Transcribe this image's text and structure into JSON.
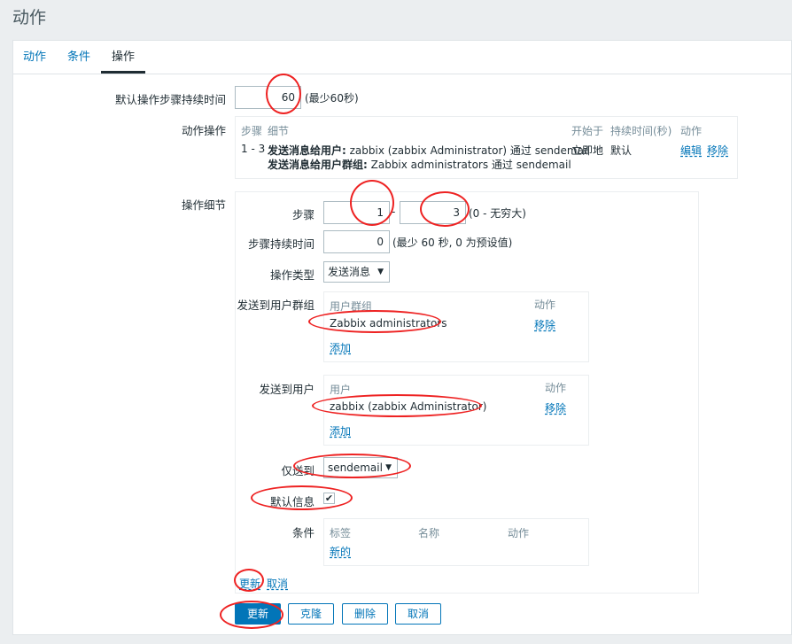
{
  "page": {
    "title": "动作"
  },
  "tabs": [
    {
      "label": "动作",
      "active": false
    },
    {
      "label": "条件",
      "active": false
    },
    {
      "label": "操作",
      "active": true
    }
  ],
  "form": {
    "default_duration": {
      "label": "默认操作步骤持续时间",
      "value": "60",
      "hint": "(最少60秒)"
    },
    "action_ops": {
      "label": "动作操作",
      "headers": {
        "steps": "步骤",
        "details": "细节",
        "start_in": "开始于",
        "duration": "持续时间(秒)",
        "action": "动作"
      },
      "row": {
        "steps": "1 - 3",
        "line1_bold": "发送消息给用户:",
        "line1_text": " zabbix (zabbix Administrator) 通过 sendemail",
        "line2_bold": "发送消息给用户群组:",
        "line2_text": " Zabbix administrators 通过 sendemail",
        "start_in": "立即地",
        "duration": "默认",
        "edit": "编辑",
        "remove": "移除"
      }
    },
    "op_details": {
      "label": "操作细节",
      "steps_label": "步骤",
      "step_from": "1",
      "step_sep": "-",
      "step_to": "3",
      "step_hint": "(0 - 无穷大)",
      "step_duration_label": "步骤持续时间",
      "step_duration": "0",
      "step_duration_hint": "(最少 60 秒, 0 为预设值)",
      "op_type_label": "操作类型",
      "op_type_value": "发送消息",
      "send_groups_label": "发送到用户群组",
      "groups_header": "用户群组",
      "groups_action_header": "动作",
      "group_item": "Zabbix administrators",
      "group_remove": "移除",
      "group_add": "添加",
      "send_users_label": "发送到用户",
      "users_header": "用户",
      "users_action_header": "动作",
      "user_item": "zabbix (zabbix Administrator)",
      "user_remove": "移除",
      "user_add": "添加",
      "send_only_label": "仅送到",
      "send_only_value": "sendemail",
      "default_msg_label": "默认信息",
      "default_msg_checked": true,
      "conditions_label": "条件",
      "cond_headers": {
        "tag": "标签",
        "name": "名称",
        "action": "动作"
      },
      "cond_new": "新的",
      "update_link": "更新",
      "cancel_link": "取消"
    }
  },
  "buttons": {
    "update": "更新",
    "clone": "克隆",
    "delete": "删除",
    "cancel": "取消"
  },
  "colors": {
    "accent": "#0275b8",
    "annotation": "#e22222"
  }
}
